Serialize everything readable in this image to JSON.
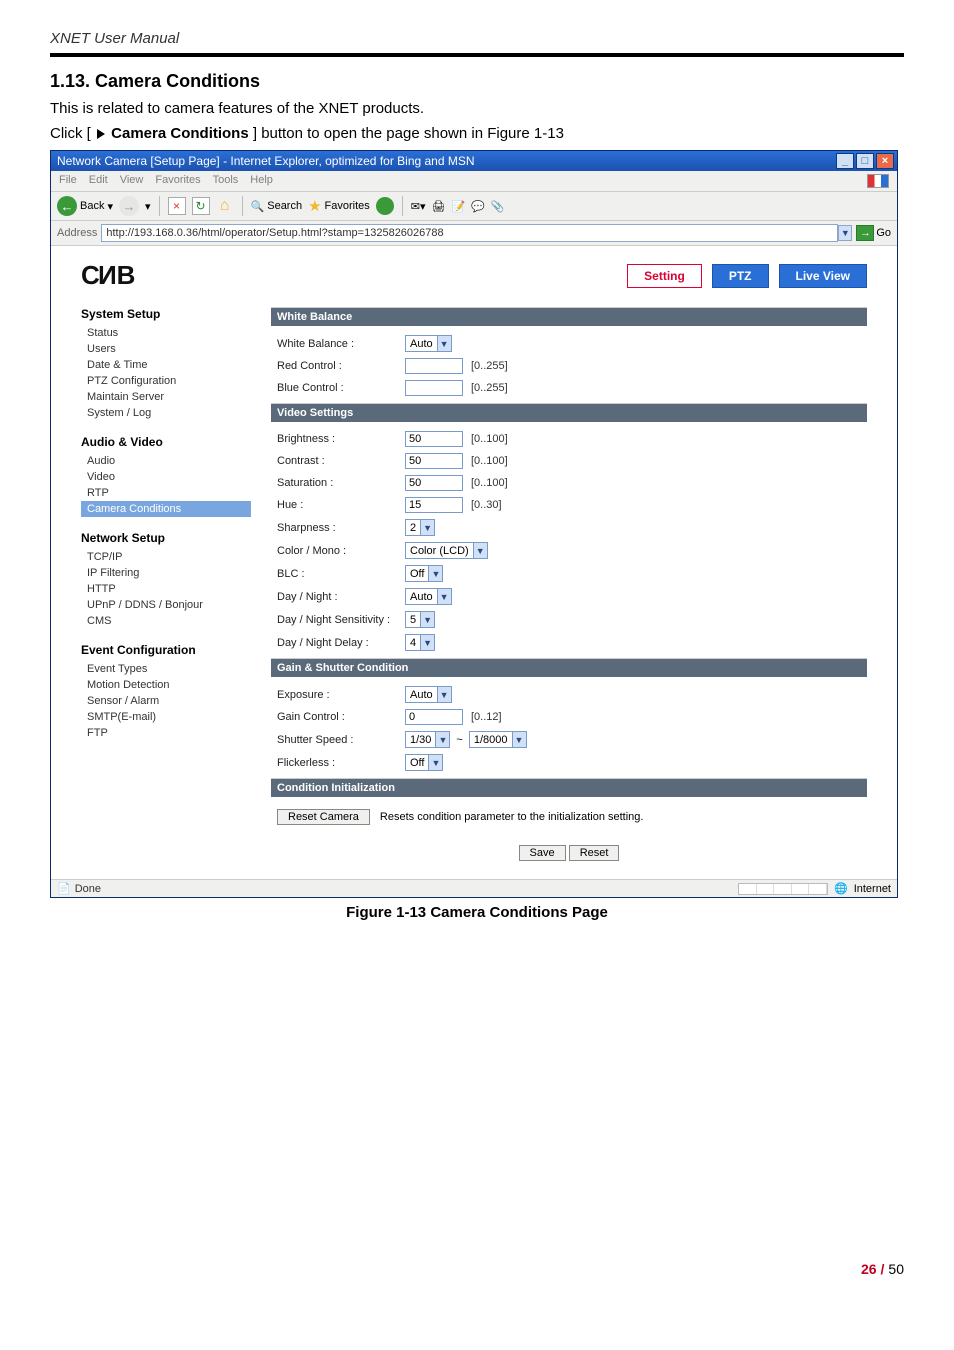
{
  "doc_header": "XNET User Manual",
  "heading": "1.13. Camera Conditions",
  "intro": "This is related to camera features of the XNET products.",
  "click_line_prefix": "Click [ ",
  "click_label": "Camera Conditions",
  "click_line_suffix": " ] button to open the page shown in Figure 1-13",
  "window": {
    "title": "Network Camera [Setup Page] - Internet Explorer, optimized for Bing and MSN",
    "menus": [
      "File",
      "Edit",
      "View",
      "Favorites",
      "Tools",
      "Help"
    ],
    "toolbar": {
      "back": "Back",
      "search": "Search",
      "favorites": "Favorites"
    },
    "address_label": "Address",
    "address": "http://193.168.0.36/html/operator/Setup.html?stamp=1325826026788",
    "go": "Go"
  },
  "tabs": {
    "setting": "Setting",
    "ptz": "PTZ",
    "live": "Live View"
  },
  "logo": "CNB",
  "sidebar": {
    "groups": [
      {
        "title": "System Setup",
        "items": [
          "Status",
          "Users",
          "Date & Time",
          "PTZ Configuration",
          "Maintain Server",
          "System / Log"
        ],
        "active": -1
      },
      {
        "title": "Audio & Video",
        "items": [
          "Audio",
          "Video",
          "RTP",
          "Camera Conditions"
        ],
        "active": 3
      },
      {
        "title": "Network Setup",
        "items": [
          "TCP/IP",
          "IP Filtering",
          "HTTP",
          "UPnP / DDNS / Bonjour",
          "CMS"
        ],
        "active": -1
      },
      {
        "title": "Event Configuration",
        "items": [
          "Event Types",
          "Motion Detection",
          "Sensor / Alarm",
          "SMTP(E-mail)",
          "FTP"
        ],
        "active": -1
      }
    ]
  },
  "form": {
    "wb": {
      "title": "White Balance",
      "rows": {
        "wb_label": "White Balance :",
        "wb_sel": "Auto",
        "red_label": "Red Control :",
        "red_val": "",
        "red_range": "[0..255]",
        "blue_label": "Blue Control :",
        "blue_val": "",
        "blue_range": "[0..255]"
      }
    },
    "video": {
      "title": "Video Settings",
      "brightness_label": "Brightness :",
      "brightness_val": "50",
      "brightness_range": "[0..100]",
      "contrast_label": "Contrast :",
      "contrast_val": "50",
      "contrast_range": "[0..100]",
      "saturation_label": "Saturation :",
      "saturation_val": "50",
      "saturation_range": "[0..100]",
      "hue_label": "Hue :",
      "hue_val": "15",
      "hue_range": "[0..30]",
      "sharpness_label": "Sharpness :",
      "sharpness_sel": "2",
      "colormono_label": "Color / Mono :",
      "colormono_sel": "Color (LCD)",
      "blc_label": "BLC :",
      "blc_sel": "Off",
      "daynight_label": "Day / Night :",
      "daynight_sel": "Auto",
      "dns_label": "Day / Night Sensitivity :",
      "dns_sel": "5",
      "dnd_label": "Day / Night Delay :",
      "dnd_sel": "4"
    },
    "gain": {
      "title": "Gain & Shutter Condition",
      "exposure_label": "Exposure :",
      "exposure_sel": "Auto",
      "gain_label": "Gain Control :",
      "gain_val": "0",
      "gain_range": "[0..12]",
      "shutter_label": "Shutter Speed :",
      "shutter_a": "1/30",
      "shutter_sep": "~",
      "shutter_b": "1/8000",
      "flicker_label": "Flickerless :",
      "flicker_sel": "Off"
    },
    "init": {
      "title": "Condition Initialization",
      "reset_camera": "Reset Camera",
      "reset_desc": "Resets condition parameter to the initialization setting."
    },
    "save": "Save",
    "reset": "Reset"
  },
  "status": {
    "done": "Done",
    "zone": "Internet"
  },
  "caption": "Figure 1-13 Camera Conditions Page",
  "footer": {
    "page": "26",
    "sep": "/",
    "total": "50"
  }
}
